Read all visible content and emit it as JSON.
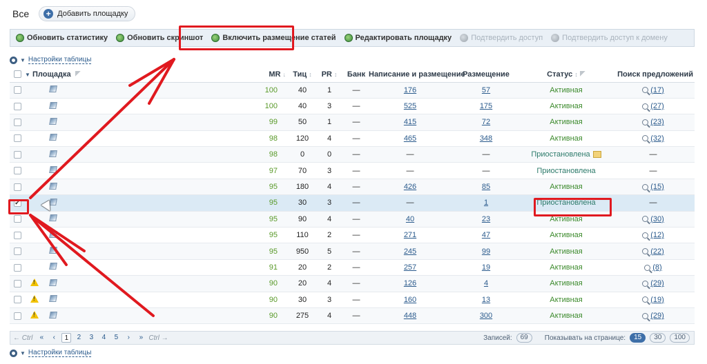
{
  "header": {
    "title": "Все",
    "add_button": "Добавить площадку"
  },
  "toolbar": {
    "update_stats": "Обновить статистику",
    "update_screenshot": "Обновить скриншот",
    "enable_articles": "Включить размещение статей",
    "edit_site": "Редактировать площадку",
    "confirm_access": "Подтвердить доступ",
    "confirm_domain": "Подтвердить доступ к домену"
  },
  "settings": {
    "label": "Настройки таблицы"
  },
  "table": {
    "columns": {
      "site": "Площадка",
      "mr": "MR",
      "tic": "Тиц",
      "pr": "PR",
      "bank": "Банк",
      "writing": "Написание и размещение",
      "placement": "Размещение",
      "status": "Статус",
      "search": "Поиск предложений"
    },
    "rows": [
      {
        "mr": "100",
        "tic": "40",
        "pr": "1",
        "bank": "—",
        "writing": "176",
        "placement": "57",
        "status": "Активная",
        "search": "(17)",
        "warn": false,
        "checked": false
      },
      {
        "mr": "100",
        "tic": "40",
        "pr": "3",
        "bank": "—",
        "writing": "525",
        "placement": "175",
        "status": "Активная",
        "search": "(27)",
        "warn": false,
        "checked": false
      },
      {
        "mr": "99",
        "tic": "50",
        "pr": "1",
        "bank": "—",
        "writing": "415",
        "placement": "72",
        "status": "Активная",
        "search": "(23)",
        "warn": false,
        "checked": false
      },
      {
        "mr": "98",
        "tic": "120",
        "pr": "4",
        "bank": "—",
        "writing": "465",
        "placement": "348",
        "status": "Активная",
        "search": "(32)",
        "warn": false,
        "checked": false
      },
      {
        "mr": "98",
        "tic": "0",
        "pr": "0",
        "bank": "—",
        "writing": "—",
        "placement": "—",
        "status": "Приостановлена",
        "search": "—",
        "warn": false,
        "checked": false
      },
      {
        "mr": "97",
        "tic": "70",
        "pr": "3",
        "bank": "—",
        "writing": "—",
        "placement": "—",
        "status": "Приостановлена",
        "search": "—",
        "warn": false,
        "checked": false
      },
      {
        "mr": "95",
        "tic": "180",
        "pr": "4",
        "bank": "—",
        "writing": "426",
        "placement": "85",
        "status": "Активная",
        "search": "(15)",
        "warn": false,
        "checked": false
      },
      {
        "mr": "95",
        "tic": "30",
        "pr": "3",
        "bank": "—",
        "writing": "—",
        "placement": "1",
        "status": "Приостановлена",
        "search": "—",
        "warn": false,
        "checked": true
      },
      {
        "mr": "95",
        "tic": "90",
        "pr": "4",
        "bank": "—",
        "writing": "40",
        "placement": "23",
        "status": "Активная",
        "search": "(30)",
        "warn": false,
        "checked": false
      },
      {
        "mr": "95",
        "tic": "110",
        "pr": "2",
        "bank": "—",
        "writing": "271",
        "placement": "47",
        "status": "Активная",
        "search": "(12)",
        "warn": false,
        "checked": false
      },
      {
        "mr": "95",
        "tic": "950",
        "pr": "5",
        "bank": "—",
        "writing": "245",
        "placement": "99",
        "status": "Активная",
        "search": "(22)",
        "warn": false,
        "checked": false
      },
      {
        "mr": "91",
        "tic": "20",
        "pr": "2",
        "bank": "—",
        "writing": "257",
        "placement": "19",
        "status": "Активная",
        "search": "(8)",
        "warn": false,
        "checked": false
      },
      {
        "mr": "90",
        "tic": "20",
        "pr": "4",
        "bank": "—",
        "writing": "126",
        "placement": "4",
        "status": "Активная",
        "search": "(29)",
        "warn": true,
        "checked": false
      },
      {
        "mr": "90",
        "tic": "30",
        "pr": "3",
        "bank": "—",
        "writing": "160",
        "placement": "13",
        "status": "Активная",
        "search": "(19)",
        "warn": true,
        "checked": false
      },
      {
        "mr": "90",
        "tic": "275",
        "pr": "4",
        "bank": "—",
        "writing": "448",
        "placement": "300",
        "status": "Активная",
        "search": "(29)",
        "warn": true,
        "checked": false
      }
    ]
  },
  "pager": {
    "ctrl_left": "← Ctrl",
    "first": "«",
    "prev": "‹",
    "pages": [
      "1",
      "2",
      "3",
      "4",
      "5"
    ],
    "next": "›",
    "last": "»",
    "ctrl_right": "Ctrl →",
    "records_label": "Записей:",
    "records_count": "69",
    "per_page_label": "Показывать на странице:",
    "per_page_options": [
      "15",
      "30",
      "100"
    ]
  },
  "colors": {
    "accent": "#3e6fa8",
    "annotation": "#e0191f",
    "active": "#3c8a2c"
  }
}
